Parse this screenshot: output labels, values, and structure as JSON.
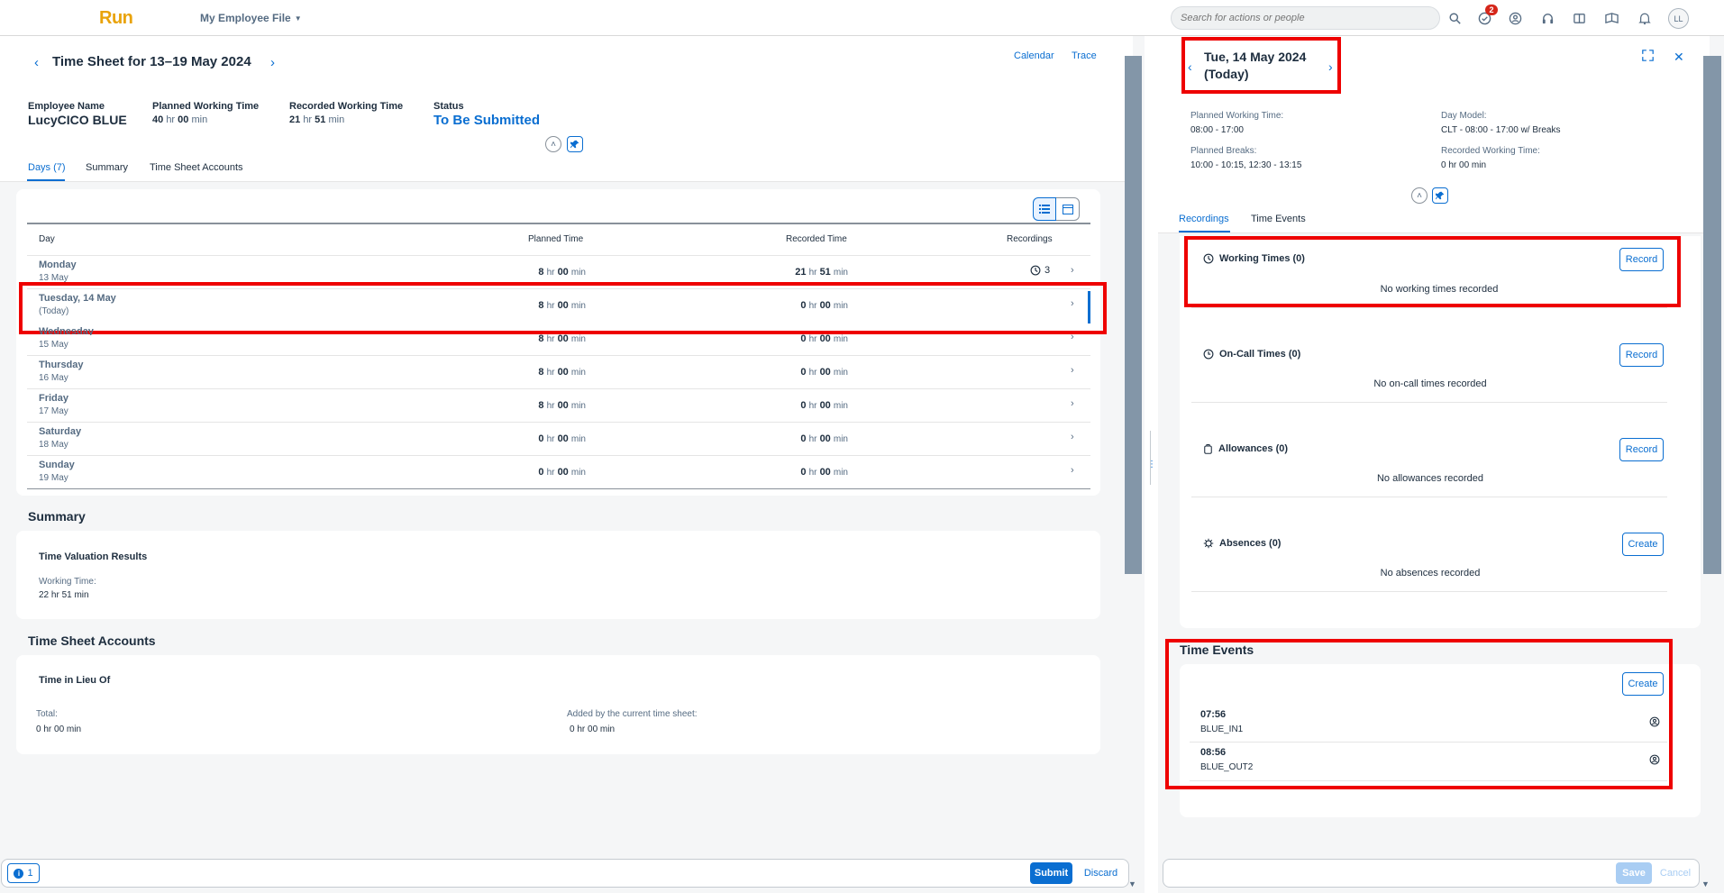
{
  "shell": {
    "logo": "Run",
    "app_menu": "My Employee File",
    "search_placeholder": "Search for actions or people",
    "notif_badge": "2",
    "avatar_initials": "LL"
  },
  "timesheet": {
    "title": "Time Sheet for 13–19 May 2024",
    "calendar_link": "Calendar",
    "trace_link": "Trace",
    "employee_label": "Employee Name",
    "employee_name": "LucyCICO BLUE",
    "planned_label": "Planned Working Time",
    "planned_hr": "40",
    "planned_min": "00",
    "recorded_label": "Recorded Working Time",
    "recorded_hr": "21",
    "recorded_min": "51",
    "status_label": "Status",
    "status_value": "To Be Submitted",
    "hr_unit": "hr",
    "min_unit": "min",
    "tabs": [
      "Days (7)",
      "Summary",
      "Time Sheet Accounts"
    ]
  },
  "days_table": {
    "headers": [
      "Day",
      "Planned Time",
      "Recorded Time",
      "Recordings"
    ],
    "rows": [
      {
        "day": "Monday",
        "sub": "13 May",
        "p_hr": "8",
        "p_min": "00",
        "r_hr": "21",
        "r_min": "51",
        "recordings": "3"
      },
      {
        "day": "Tuesday, 14 May",
        "sub": "(Today)",
        "p_hr": "8",
        "p_min": "00",
        "r_hr": "0",
        "r_min": "00",
        "recordings": ""
      },
      {
        "day": "Wednesday",
        "sub": "15 May",
        "p_hr": "8",
        "p_min": "00",
        "r_hr": "0",
        "r_min": "00",
        "recordings": ""
      },
      {
        "day": "Thursday",
        "sub": "16 May",
        "p_hr": "8",
        "p_min": "00",
        "r_hr": "0",
        "r_min": "00",
        "recordings": ""
      },
      {
        "day": "Friday",
        "sub": "17 May",
        "p_hr": "8",
        "p_min": "00",
        "r_hr": "0",
        "r_min": "00",
        "recordings": ""
      },
      {
        "day": "Saturday",
        "sub": "18 May",
        "p_hr": "0",
        "p_min": "00",
        "r_hr": "0",
        "r_min": "00",
        "recordings": ""
      },
      {
        "day": "Sunday",
        "sub": "19 May",
        "p_hr": "0",
        "p_min": "00",
        "r_hr": "0",
        "r_min": "00",
        "recordings": ""
      }
    ]
  },
  "summary": {
    "title": "Summary",
    "card_title": "Time Valuation Results",
    "working_label": "Working Time:",
    "working_value": "22 hr 51 min"
  },
  "accounts": {
    "title": "Time Sheet Accounts",
    "card_title": "Time in Lieu Of",
    "total_label": "Total:",
    "total_value": "0 hr 00 min",
    "added_label": "Added by the current time sheet:",
    "added_value": "0 hr 00 min"
  },
  "footer": {
    "message_count": "1",
    "submit": "Submit",
    "discard": "Discard"
  },
  "day_detail": {
    "title_line1": "Tue, 14 May 2024",
    "title_line2": "(Today)",
    "planned_label": "Planned Working Time:",
    "planned_value": "08:00 - 17:00",
    "day_model_label": "Day Model:",
    "day_model_value": "CLT - 08:00 - 17:00 w/ Breaks",
    "breaks_label": "Planned Breaks:",
    "breaks_value": "10:00 - 10:15, 12:30 - 13:15",
    "recorded_label": "Recorded Working Time:",
    "recorded_value": "0 hr 00 min",
    "tabs": [
      "Recordings",
      "Time Events"
    ],
    "sections": [
      {
        "title": "Working Times (0)",
        "empty": "No working times recorded",
        "action": "Record"
      },
      {
        "title": "On-Call Times (0)",
        "empty": "No on-call times recorded",
        "action": "Record"
      },
      {
        "title": "Allowances (0)",
        "empty": "No allowances recorded",
        "action": "Record"
      },
      {
        "title": "Absences (0)",
        "empty": "No absences recorded",
        "action": "Create"
      }
    ],
    "time_events_title": "Time Events",
    "time_events_create": "Create",
    "events": [
      {
        "time": "07:56",
        "type": "BLUE_IN1"
      },
      {
        "time": "08:56",
        "type": "BLUE_OUT2"
      }
    ],
    "save": "Save",
    "cancel": "Cancel"
  },
  "colors": {
    "accent": "#0a6ed1",
    "highlight": "#e00000",
    "logo": "#e9a30a",
    "badge": "#d5261a"
  }
}
